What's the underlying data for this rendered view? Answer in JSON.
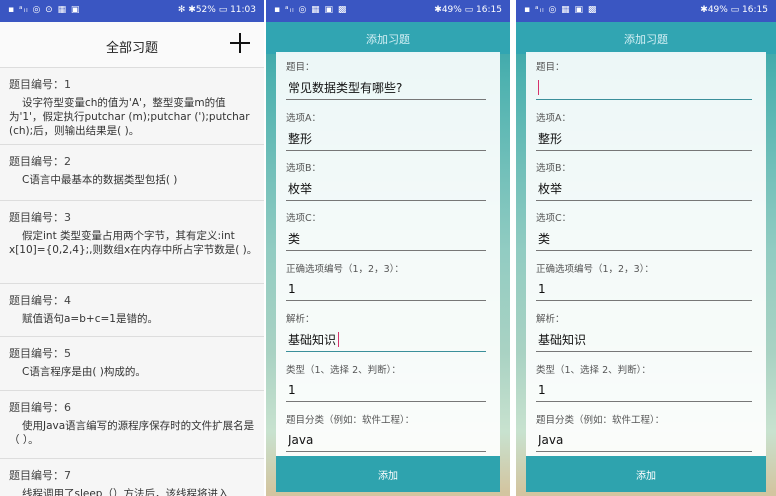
{
  "status_bars": [
    {
      "left": "▪ ᵃᵢₗ ◎ ⊙ ▦ ▣",
      "right": "✻ ✱52% ▭ 11:03"
    },
    {
      "left": "▪ ᵃᵢₗ ◎ ▦ ▣ ▩",
      "right": "✱49% ▭ 16:15"
    },
    {
      "left": "▪ ᵃᵢₗ ◎ ▦ ▣ ▩",
      "right": "✱49% ▭ 16:15"
    }
  ],
  "panel1": {
    "title": "全部习题",
    "add_icon": "plus-icon",
    "questions": [
      {
        "num": "题目编号：1",
        "text": "设字符型变量ch的值为'A'，整型变量m的值为'1'，假定执行putchar (m);putchar (');putchar (ch);后，则输出结果是( )。"
      },
      {
        "num": "题目编号：2",
        "text": "C语言中最基本的数据类型包括( )"
      },
      {
        "num": "题目编号：3",
        "text": "假定int 类型变量占用两个字节，其有定义:int x[10]={0,2,4};,则数组x在内存中所占字节数是( )。"
      },
      {
        "num": "题目编号：4",
        "text": "赋值语句a=b+c=1是错的。"
      },
      {
        "num": "题目编号：5",
        "text": "C语言程序是由( )构成的。"
      },
      {
        "num": "题目编号：6",
        "text": "使用Java语言编写的源程序保存时的文件扩展名是（ ）。"
      },
      {
        "num": "题目编号：7",
        "text": "线程调用了sleep（）方法后，该线程将进入"
      }
    ]
  },
  "form_common": {
    "title": "添加习题",
    "labels": {
      "question": "题目：",
      "option_a": "选项A：",
      "option_b": "选项B：",
      "option_c": "选项C：",
      "correct": "正确选项编号（1，2，3）：",
      "analysis": "解析：",
      "type": "类型（1、选择 2、判断）：",
      "category": "题目分类（例如：软件工程）："
    },
    "add_button": "添加"
  },
  "panel2_values": {
    "question": "常见数据类型有哪些?",
    "option_a": "整形",
    "option_b": "枚举",
    "option_c": "类",
    "correct": "1",
    "analysis": "基础知识",
    "type": "1",
    "category": "Java"
  },
  "panel3_values": {
    "question": "",
    "option_a": "整形",
    "option_b": "枚举",
    "option_c": "类",
    "correct": "1",
    "analysis": "基础知识",
    "type": "1",
    "category": "Java"
  },
  "colors": {
    "status_bar": "#3a56c2",
    "accent": "#2ea3ae",
    "caret": "#d6336c"
  }
}
